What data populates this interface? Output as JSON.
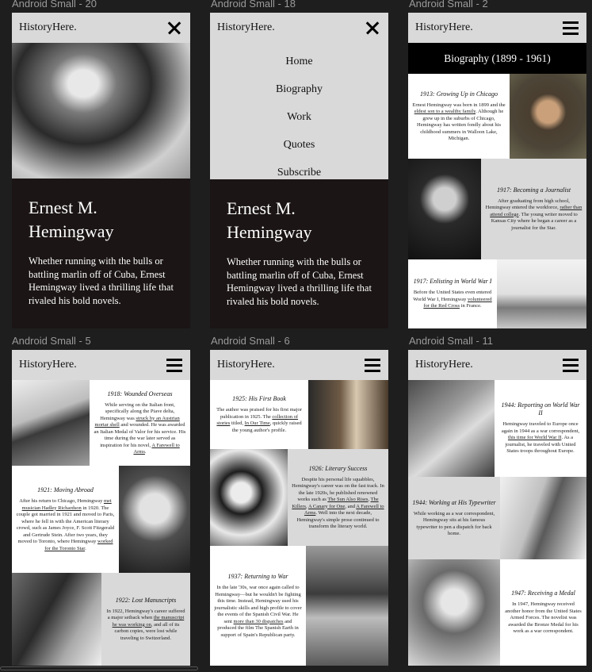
{
  "frames": [
    {
      "label": "Android Small - 20"
    },
    {
      "label": "Android Small - 18"
    },
    {
      "label": "Android Small - 2"
    },
    {
      "label": "Android Small - 5"
    },
    {
      "label": "Android Small - 6"
    },
    {
      "label": "Android Small - 11"
    }
  ],
  "brand": {
    "logo": "HistoryHere."
  },
  "hero": {
    "title": "Ernest M. Hemingway",
    "description": "Whether running with the bulls or battling marlin off of Cuba, Ernest Hemingway lived a thrilling life that rivaled his bold novels."
  },
  "menu": {
    "items": [
      "Home",
      "Biography",
      "Work",
      "Quotes",
      "Subscribe"
    ]
  },
  "biography": {
    "heading": "Biography (1899 - 1961)"
  },
  "entries": {
    "e1913": {
      "title": "1913: Growing Up in Chicago",
      "pre": "Ernest Hemingway was born in 1899 and the ",
      "link": "eldest son to a wealthy family",
      "post": ". Although he grew up in the suburbs of Chicago, Hemingway has written fondly about his childhood summers in Walloon Lake, Michigan."
    },
    "e1917a": {
      "title": "1917: Becoming a Journalist",
      "pre": "After graduating from high school, Hemingway entered the workforce, ",
      "link": "rather than attend college",
      "post": ". The young writer moved to Kansas City where he began a career as a journalist for the Star."
    },
    "e1917b": {
      "title": "1917: Enlisting in World War I",
      "pre": "Before the United States even entered World War I, Hemingway ",
      "link": "volunteered for the Red Cross",
      "post": " in France."
    },
    "e1918": {
      "title": "1918: Wounded Overseas",
      "pre": "While serving on the Italian front, specifically along the Piave delta, Hemingway was ",
      "link": "struck by an Austrian mortar shell",
      "mid": " and wounded. He was awarded an Italian Medal of Valor for his service. His time during the war later served as inspiration for his novel, ",
      "link2": "A Farewell to Arms",
      "post": "."
    },
    "e1921": {
      "title": "1921: Moving Abroad",
      "pre": "After his return to Chicago, Hemingway ",
      "link": "met musician Hadley Richardson",
      "mid": " in 1920. The couple got married in 1921 and moved to Paris, where he fell in with the American literary crowd, such as James Joyce, F. Scott Fitzgerald and Gertrude Stein. After two years, they moved to Toronto, where Hemingway ",
      "link2": "worked for the Toronto Star",
      "post": "."
    },
    "e1922": {
      "title": "1922: Lost Manuscripts",
      "pre": "In 1922, Hemingway's career suffered a major setback when ",
      "link": "the manuscript he was working on",
      "post": ", and all of its carbon copies, were lost while traveling to Switzerland."
    },
    "e1925": {
      "title": "1925: His First Book",
      "pre": "The author was praised for his first major publication in 1925. The ",
      "link": "collection of stories",
      "mid": " titled, ",
      "link2": "In Our Time",
      "post": ", quickly raised the young author's profile."
    },
    "e1926": {
      "title": "1926: Literary Success",
      "pre": "Despite his personal life squabbles, Hemingway's career was on the fast track. In the late 1920s, he published renowned works such as ",
      "link": "The Sun Also Rises",
      "mid": ", ",
      "link2": "The Killers",
      "mid2": ", ",
      "link3": "A Canary for One",
      "mid3": ", and ",
      "link4": "A Farewell to Arms",
      "post": ". Well into the next decade, Hemingway's simple prose continued to transform the literary world."
    },
    "e1937": {
      "title": "1937: Returning to War",
      "pre": "In the late '30s, war once again called to Hemingway—but he wouldn't be fighting this time. Instead, Hemingway used his journalistic skills and high profile to cover the events of the Spanish Civil War. He sent ",
      "link": "more than 30 dispatches",
      "post": " and produced the film The Spanish Earth in support of Spain's Republican party."
    },
    "e1944a": {
      "title": "1944: Reporting on World War II",
      "pre": "Hemingway traveled to Europe once again in 1944 as a war correspondent, ",
      "link": "this time for World War II",
      "post": ". As a journalist, he traveled with United States troops throughout Europe."
    },
    "e1944b": {
      "title": "1944: Working at His Typewriter",
      "pre": "While working as a war correspondent, Hemingway sits at his famous typewriter to pen a dispatch for back home.",
      "link": "",
      "post": ""
    },
    "e1947": {
      "title": "1947: Receiving a Medal",
      "pre": "In 1947, Hemingway received another honor from the United States Armed Forces. The novelist was awarded the Bronze Medal for his work as a war correspondent.",
      "link": "",
      "post": ""
    }
  }
}
